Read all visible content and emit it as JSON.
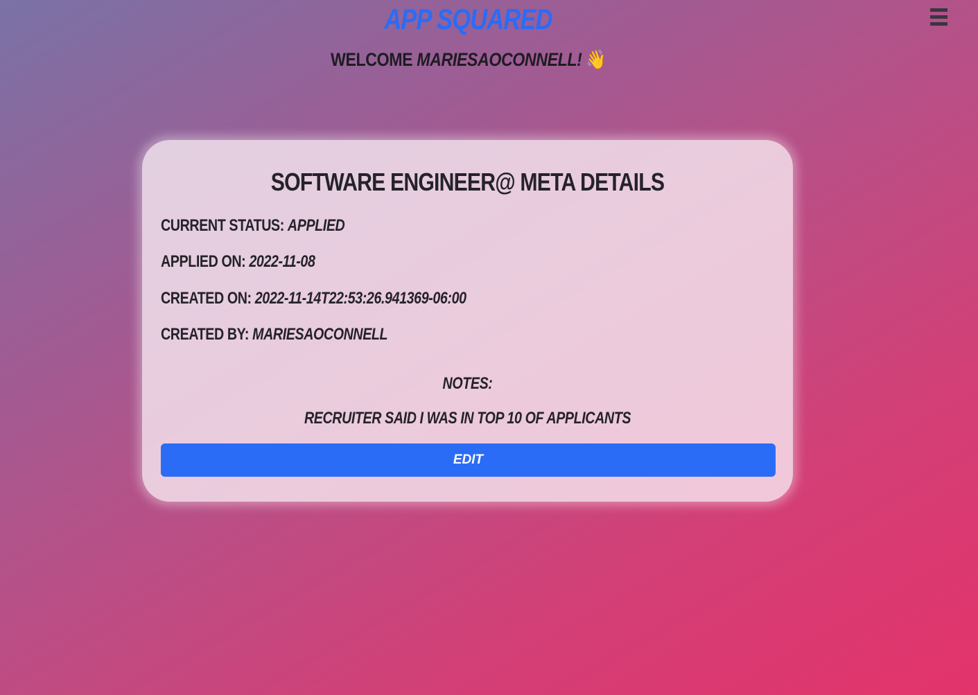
{
  "header": {
    "app_title": "App Squared",
    "welcome_prefix": "Welcome ",
    "welcome_user": "mariesaoconnell!",
    "wave_emoji": "👋",
    "menu_icon": "hamburger-menu-icon"
  },
  "details": {
    "title": "Software Engineer@ Meta Details",
    "status_label": "Current Status: ",
    "status_value": "applied",
    "applied_label": "Applied On: ",
    "applied_value": "2022-11-08",
    "created_label": "Created On: ",
    "created_value": "2022-11-14T22:53:26.941369-06:00",
    "created_by_label": "Created By: ",
    "created_by_value": "mariesaoconnell",
    "notes_label": "Notes:",
    "notes_text": "Recruiter said I was in top 10 of applicants",
    "edit_label": "Edit"
  },
  "colors": {
    "accent": "#2a6cf6",
    "gradient_start": "#7a72a6",
    "gradient_end": "#e3336b"
  }
}
